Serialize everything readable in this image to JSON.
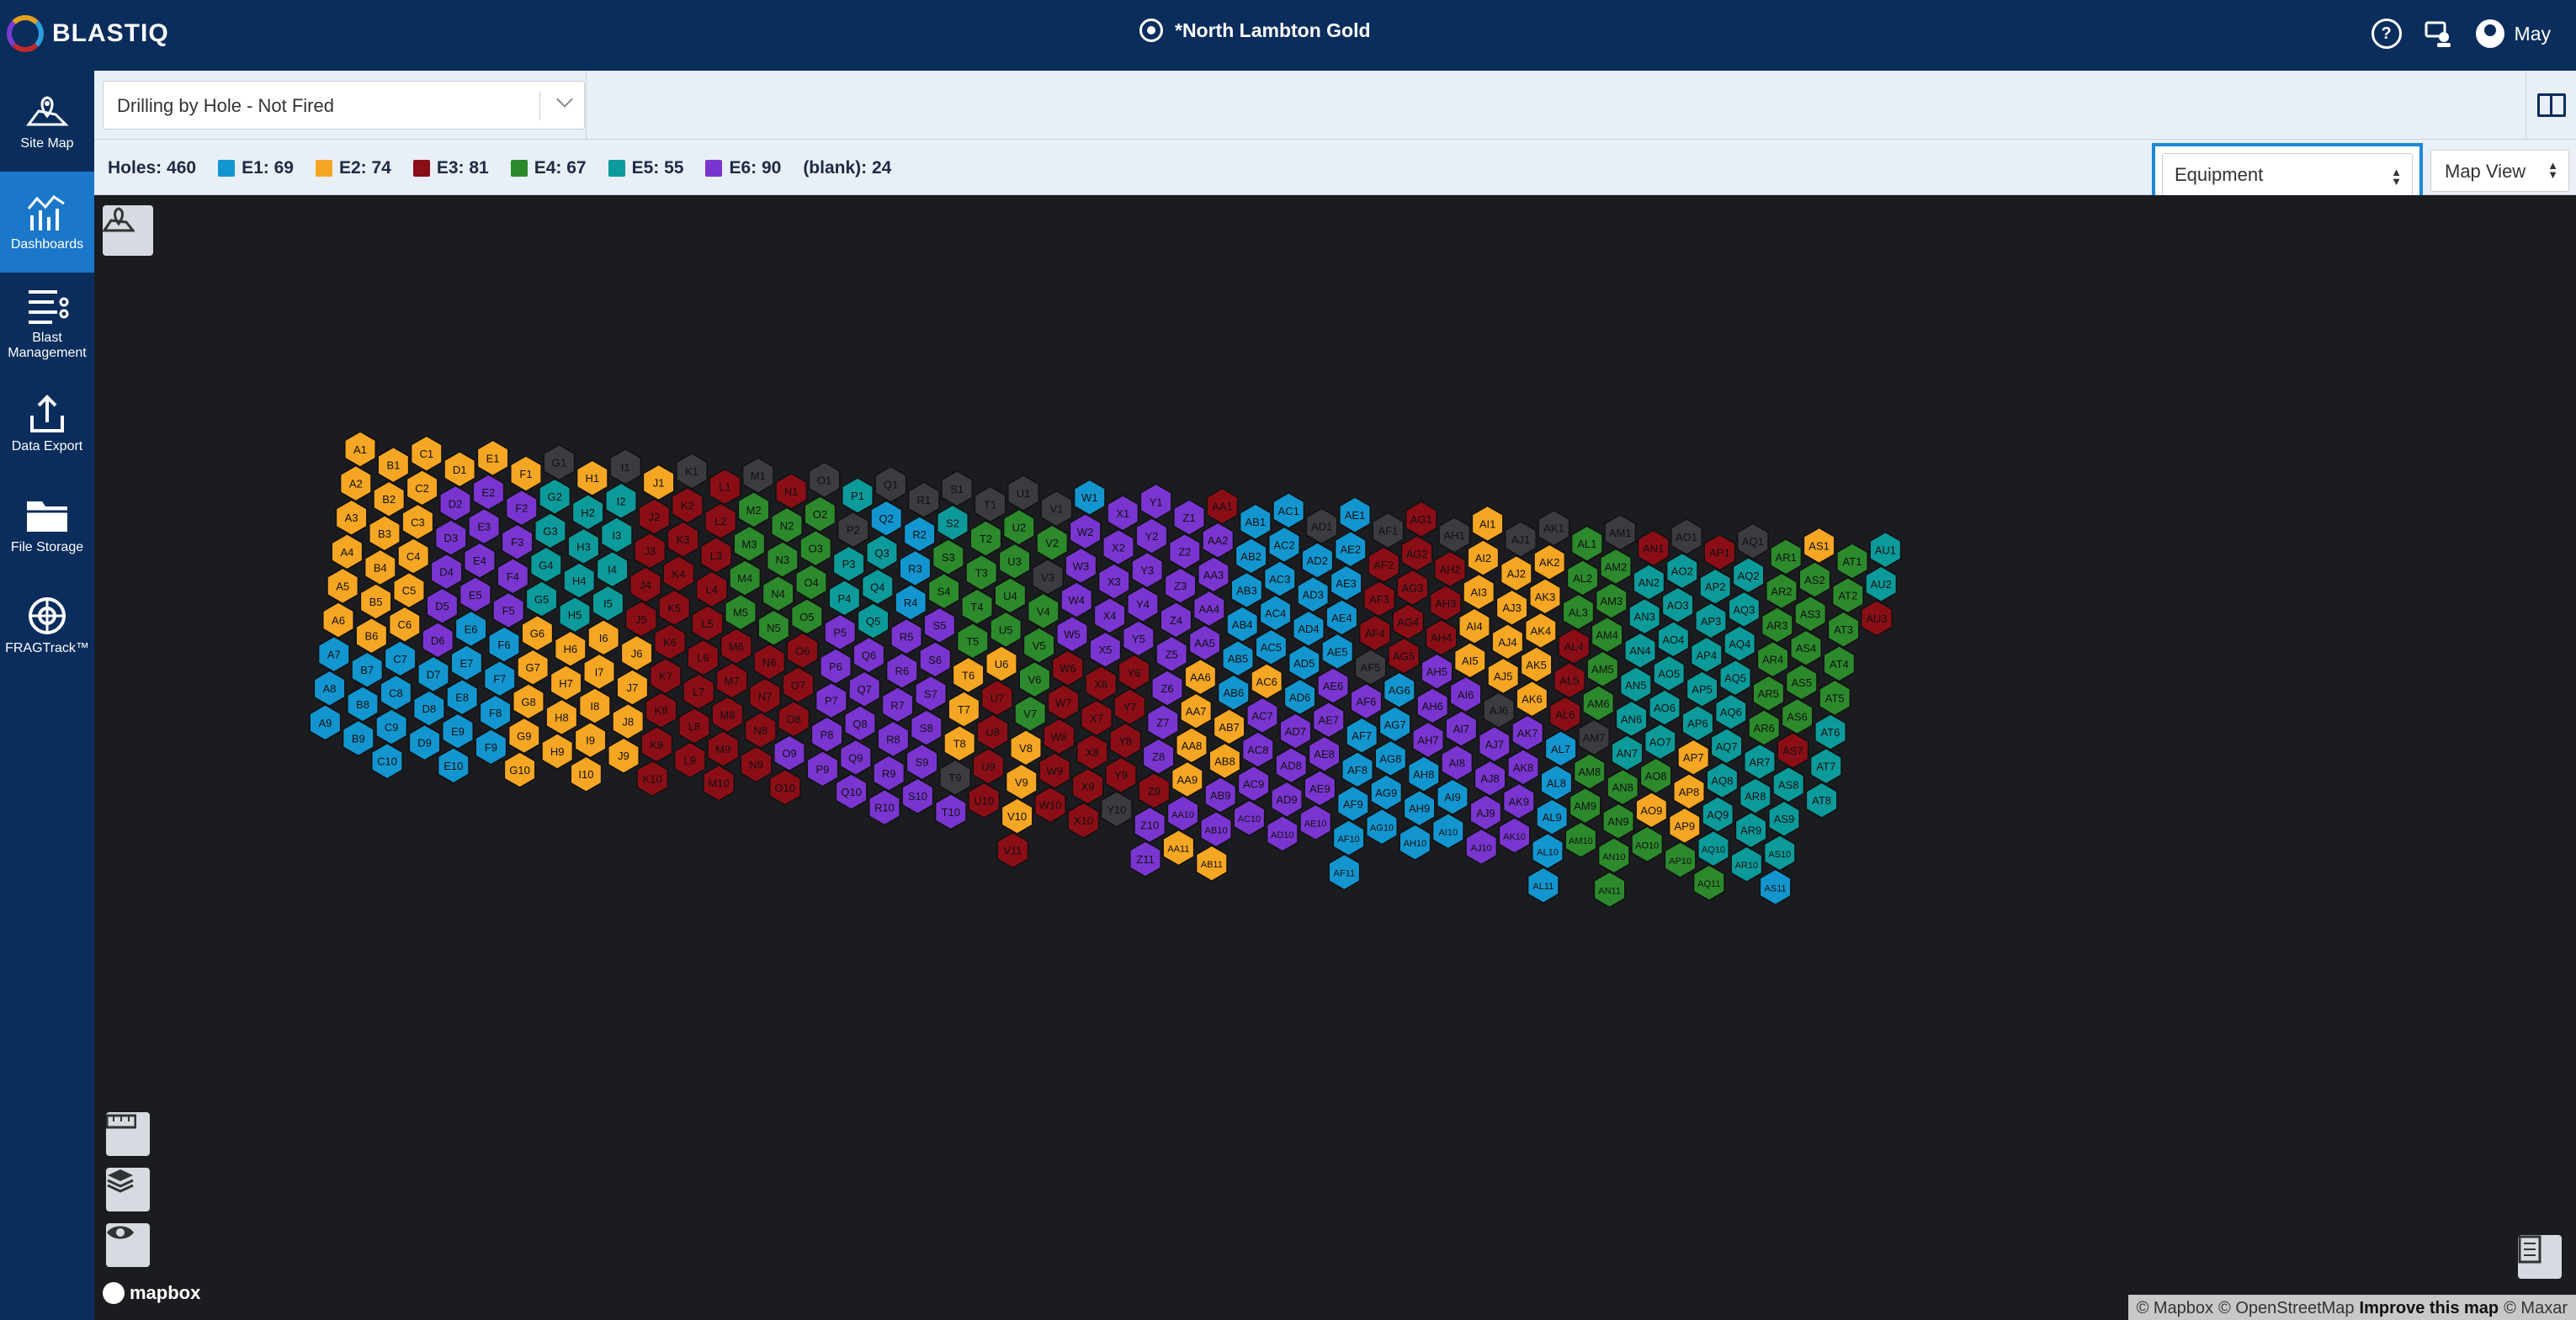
{
  "app": {
    "logo_text": "BLASTIQ",
    "site_title": "*North Lambton Gold",
    "user_name": "May"
  },
  "sidebar": {
    "items": [
      {
        "label": "Site Map",
        "icon": "map-pin-icon",
        "active": false
      },
      {
        "label": "Dashboards",
        "icon": "dashboard-chart-icon",
        "active": true
      },
      {
        "label": "Blast Management",
        "icon": "blast-management-icon",
        "active": false
      },
      {
        "label": "Data Export",
        "icon": "upload-icon",
        "active": false
      },
      {
        "label": "File Storage",
        "icon": "folder-icon",
        "active": false
      },
      {
        "label": "FRAGTrack™",
        "icon": "fragtrack-icon",
        "active": false
      }
    ]
  },
  "toolbar": {
    "report_select_value": "Drilling by Hole - Not Fired"
  },
  "legend": {
    "holes": "Holes: 460",
    "items": [
      {
        "label": "E1: 69",
        "color": "#1396cf"
      },
      {
        "label": "E2: 74",
        "color": "#f5a623"
      },
      {
        "label": "E3: 81",
        "color": "#8b0e17"
      },
      {
        "label": "E4: 67",
        "color": "#2c8a2c"
      },
      {
        "label": "E5: 55",
        "color": "#0d9a9a"
      },
      {
        "label": "E6: 90",
        "color": "#7a35d0"
      }
    ],
    "blank": "(blank): 24"
  },
  "controls": {
    "color_by": "Equipment",
    "view_mode": "Map View"
  },
  "map": {
    "blank_color": "#3b3c40",
    "mapbox_label": "mapbox",
    "attribution": [
      "© Mapbox",
      "© OpenStreetMap",
      "Improve this map",
      "© Maxar"
    ],
    "columns": [
      {
        "letter": "A",
        "labels": [
          "A1",
          "A2",
          "A3",
          "A4",
          "A5",
          "A6",
          "A7",
          "A8",
          "A9"
        ],
        "e": [
          2,
          2,
          2,
          2,
          2,
          2,
          1,
          1,
          1
        ]
      },
      {
        "letter": "B",
        "labels": [
          "B1",
          "B2",
          "B3",
          "B4",
          "B5",
          "B6",
          "B7",
          "B8",
          "B9"
        ],
        "e": [
          2,
          2,
          2,
          2,
          2,
          2,
          1,
          1,
          1
        ]
      },
      {
        "letter": "C",
        "labels": [
          "C1",
          "C2",
          "C3",
          "C4",
          "C5",
          "C6",
          "C7",
          "C8",
          "C9",
          "C10"
        ],
        "e": [
          2,
          2,
          2,
          2,
          2,
          2,
          1,
          1,
          1,
          1
        ]
      },
      {
        "letter": "D",
        "labels": [
          "D1",
          "D2",
          "D3",
          "D4",
          "D5",
          "D6",
          "D7",
          "D8",
          "D9"
        ],
        "e": [
          2,
          6,
          6,
          6,
          6,
          6,
          1,
          1,
          1
        ]
      },
      {
        "letter": "E",
        "labels": [
          "E1",
          "E2",
          "E3",
          "E4",
          "E5",
          "E6",
          "E7",
          "E8",
          "E9",
          "E10"
        ],
        "e": [
          2,
          6,
          6,
          6,
          6,
          1,
          1,
          1,
          1,
          1
        ]
      },
      {
        "letter": "F",
        "labels": [
          "F1",
          "F2",
          "F3",
          "F4",
          "F5",
          "F6",
          "F7",
          "F8",
          "F9"
        ],
        "e": [
          2,
          6,
          6,
          6,
          6,
          1,
          1,
          1,
          1
        ]
      },
      {
        "letter": "G",
        "labels": [
          "G1",
          "G2",
          "G3",
          "G4",
          "G5",
          "G6",
          "G7",
          "G8",
          "G9",
          "G10"
        ],
        "e": [
          0,
          5,
          5,
          5,
          5,
          2,
          2,
          2,
          2,
          2
        ]
      },
      {
        "letter": "H",
        "labels": [
          "H1",
          "H2",
          "H3",
          "H4",
          "H5",
          "H6",
          "H7",
          "H8",
          "H9"
        ],
        "e": [
          2,
          5,
          5,
          5,
          5,
          2,
          2,
          2,
          2
        ]
      },
      {
        "letter": "I",
        "labels": [
          "I1",
          "I2",
          "I3",
          "I4",
          "I5",
          "I6",
          "I7",
          "I8",
          "I9",
          "I10"
        ],
        "e": [
          0,
          5,
          5,
          5,
          5,
          2,
          2,
          2,
          2,
          2
        ]
      },
      {
        "letter": "J",
        "labels": [
          "J1",
          "J2",
          "J3",
          "J4",
          "J5",
          "J6",
          "J7",
          "J8",
          "J9"
        ],
        "e": [
          2,
          3,
          3,
          3,
          3,
          2,
          2,
          2,
          2
        ]
      },
      {
        "letter": "K",
        "labels": [
          "K1",
          "K2",
          "K3",
          "K4",
          "K5",
          "K6",
          "K7",
          "K8",
          "K9",
          "K10"
        ],
        "e": [
          0,
          3,
          3,
          3,
          3,
          3,
          3,
          3,
          3,
          3
        ]
      },
      {
        "letter": "L",
        "labels": [
          "L1",
          "L2",
          "L3",
          "L4",
          "L5",
          "L6",
          "L7",
          "L8",
          "L9"
        ],
        "e": [
          3,
          3,
          3,
          3,
          3,
          3,
          3,
          3,
          3
        ]
      },
      {
        "letter": "M",
        "labels": [
          "M1",
          "M2",
          "M3",
          "M4",
          "M5",
          "M6",
          "M7",
          "M8",
          "M9",
          "M10"
        ],
        "e": [
          0,
          4,
          4,
          4,
          4,
          3,
          3,
          3,
          3,
          3
        ]
      },
      {
        "letter": "N",
        "labels": [
          "N1",
          "N2",
          "N3",
          "N4",
          "N5",
          "N6",
          "N7",
          "N8",
          "N9"
        ],
        "e": [
          3,
          4,
          4,
          4,
          4,
          3,
          3,
          3,
          3
        ]
      },
      {
        "letter": "O",
        "labels": [
          "O1",
          "O2",
          "O3",
          "O4",
          "O5",
          "O6",
          "O7",
          "O8",
          "O9",
          "O10"
        ],
        "e": [
          0,
          4,
          4,
          4,
          4,
          3,
          3,
          3,
          6,
          3
        ]
      },
      {
        "letter": "P",
        "labels": [
          "P1",
          "P2",
          "P3",
          "P4",
          "P5",
          "P6",
          "P7",
          "P8",
          "P9"
        ],
        "e": [
          5,
          0,
          5,
          5,
          6,
          6,
          6,
          6,
          6
        ]
      },
      {
        "letter": "Q",
        "labels": [
          "Q1",
          "Q2",
          "Q3",
          "Q4",
          "Q5",
          "Q6",
          "Q7",
          "Q8",
          "Q9",
          "Q10"
        ],
        "e": [
          0,
          1,
          5,
          5,
          5,
          6,
          6,
          6,
          6,
          6
        ]
      },
      {
        "letter": "R",
        "labels": [
          "R1",
          "R2",
          "R3",
          "R4",
          "R5",
          "R6",
          "R7",
          "R8",
          "R9",
          "R10"
        ],
        "e": [
          0,
          1,
          1,
          1,
          6,
          6,
          6,
          6,
          6,
          6
        ]
      },
      {
        "letter": "S",
        "labels": [
          "S1",
          "S2",
          "S3",
          "S4",
          "S5",
          "S6",
          "S7",
          "S8",
          "S9",
          "S10"
        ],
        "e": [
          0,
          5,
          4,
          4,
          6,
          6,
          6,
          6,
          6,
          6
        ]
      },
      {
        "letter": "T",
        "labels": [
          "T1",
          "T2",
          "T3",
          "T4",
          "T5",
          "T6",
          "T7",
          "T8",
          "T9",
          "T10"
        ],
        "e": [
          0,
          4,
          4,
          4,
          4,
          2,
          2,
          2,
          0,
          6
        ]
      },
      {
        "letter": "U",
        "labels": [
          "U1",
          "U2",
          "U3",
          "U4",
          "U5",
          "U6",
          "U7",
          "U8",
          "U9",
          "U10"
        ],
        "e": [
          0,
          4,
          4,
          4,
          4,
          2,
          3,
          3,
          3,
          3
        ]
      },
      {
        "letter": "V",
        "labels": [
          "V1",
          "V2",
          "V3",
          "V4",
          "V5",
          "V6",
          "V7",
          "V8",
          "V9",
          "V10",
          "V11"
        ],
        "e": [
          0,
          4,
          0,
          4,
          4,
          4,
          4,
          2,
          2,
          2,
          3
        ]
      },
      {
        "letter": "W",
        "labels": [
          "W1",
          "W2",
          "W3",
          "W4",
          "W5",
          "W6",
          "W7",
          "W8",
          "W9",
          "W10"
        ],
        "e": [
          1,
          6,
          6,
          6,
          6,
          3,
          3,
          3,
          3,
          3
        ]
      },
      {
        "letter": "X",
        "labels": [
          "X1",
          "X2",
          "X3",
          "X4",
          "X5",
          "X6",
          "X7",
          "X8",
          "X9",
          "X10"
        ],
        "e": [
          6,
          6,
          6,
          6,
          6,
          3,
          3,
          3,
          3,
          3
        ]
      },
      {
        "letter": "Y",
        "labels": [
          "Y1",
          "Y2",
          "Y3",
          "Y4",
          "Y5",
          "Y6",
          "Y7",
          "Y8",
          "Y9",
          "Y10"
        ],
        "e": [
          6,
          6,
          6,
          6,
          6,
          3,
          3,
          3,
          3,
          0
        ]
      },
      {
        "letter": "Z",
        "labels": [
          "Z1",
          "Z2",
          "Z3",
          "Z4",
          "Z5",
          "Z6",
          "Z7",
          "Z8",
          "Z9",
          "Z10",
          "Z11"
        ],
        "e": [
          6,
          6,
          6,
          6,
          6,
          6,
          6,
          6,
          3,
          6,
          6
        ]
      },
      {
        "letter": "AA",
        "labels": [
          "AA1",
          "AA2",
          "AA3",
          "AA4",
          "AA5",
          "AA6",
          "AA7",
          "AA8",
          "AA9",
          "AA10",
          "AA11"
        ],
        "e": [
          3,
          6,
          6,
          6,
          6,
          2,
          2,
          2,
          2,
          6,
          2
        ]
      },
      {
        "letter": "AB",
        "labels": [
          "AB1",
          "AB2",
          "AB3",
          "AB4",
          "AB5",
          "AB6",
          "AB7",
          "AB8",
          "AB9",
          "AB10",
          "AB11"
        ],
        "e": [
          1,
          1,
          1,
          1,
          1,
          1,
          2,
          2,
          6,
          6,
          2
        ]
      },
      {
        "letter": "AC",
        "labels": [
          "AC1",
          "AC2",
          "AC3",
          "AC4",
          "AC5",
          "AC6",
          "AC7",
          "AC8",
          "AC9",
          "AC10"
        ],
        "e": [
          1,
          1,
          1,
          1,
          1,
          2,
          6,
          6,
          6,
          6
        ]
      },
      {
        "letter": "AD",
        "labels": [
          "AD1",
          "AD2",
          "AD3",
          "AD4",
          "AD5",
          "AD6",
          "AD7",
          "AD8",
          "AD9",
          "AD10"
        ],
        "e": [
          0,
          1,
          1,
          1,
          1,
          1,
          6,
          6,
          6,
          6
        ]
      },
      {
        "letter": "AE",
        "labels": [
          "AE1",
          "AE2",
          "AE3",
          "AE4",
          "AE5",
          "AE6",
          "AE7",
          "AE8",
          "AE9",
          "AE10"
        ],
        "e": [
          1,
          1,
          1,
          1,
          1,
          6,
          6,
          6,
          6,
          6
        ]
      },
      {
        "letter": "AF",
        "labels": [
          "AF1",
          "AF2",
          "AF3",
          "AF4",
          "AF5",
          "AF6",
          "AF7",
          "AF8",
          "AF9",
          "AF10",
          "AF11"
        ],
        "e": [
          0,
          3,
          3,
          3,
          0,
          6,
          1,
          1,
          1,
          1,
          1
        ]
      },
      {
        "letter": "AG",
        "labels": [
          "AG1",
          "AG2",
          "AG3",
          "AG4",
          "AG5",
          "AG6",
          "AG7",
          "AG8",
          "AG9",
          "AG10"
        ],
        "e": [
          3,
          3,
          3,
          3,
          3,
          1,
          1,
          1,
          1,
          1
        ]
      },
      {
        "letter": "AH",
        "labels": [
          "AH1",
          "AH2",
          "AH3",
          "AH4",
          "AH5",
          "AH6",
          "AH7",
          "AH8",
          "AH9",
          "AH10"
        ],
        "e": [
          0,
          3,
          3,
          3,
          6,
          6,
          6,
          1,
          1,
          1
        ]
      },
      {
        "letter": "AI",
        "labels": [
          "AI1",
          "AI2",
          "AI3",
          "AI4",
          "AI5",
          "AI6",
          "AI7",
          "AI8",
          "AI9",
          "AI10"
        ],
        "e": [
          2,
          2,
          2,
          2,
          2,
          6,
          6,
          6,
          1,
          1
        ]
      },
      {
        "letter": "AJ",
        "labels": [
          "AJ1",
          "AJ2",
          "AJ3",
          "AJ4",
          "AJ5",
          "AJ6",
          "AJ7",
          "AJ8",
          "AJ9",
          "AJ10"
        ],
        "e": [
          0,
          2,
          2,
          2,
          2,
          0,
          6,
          6,
          6,
          6
        ]
      },
      {
        "letter": "AK",
        "labels": [
          "AK1",
          "AK2",
          "AK3",
          "AK4",
          "AK5",
          "AK6",
          "AK7",
          "AK8",
          "AK9",
          "AK10"
        ],
        "e": [
          0,
          2,
          2,
          2,
          2,
          2,
          6,
          6,
          6,
          6
        ]
      },
      {
        "letter": "AL",
        "labels": [
          "AL1",
          "AL2",
          "AL3",
          "AL4",
          "AL5",
          "AL6",
          "AL7",
          "AL8",
          "AL9",
          "AL10",
          "AL11"
        ],
        "e": [
          4,
          4,
          4,
          3,
          3,
          3,
          1,
          1,
          1,
          1,
          1
        ]
      },
      {
        "letter": "AM",
        "labels": [
          "AM1",
          "AM2",
          "AM3",
          "AM4",
          "AM5",
          "AM6",
          "AM7",
          "AM8",
          "AM9",
          "AM10"
        ],
        "e": [
          0,
          4,
          4,
          4,
          4,
          4,
          0,
          4,
          4,
          4
        ]
      },
      {
        "letter": "AN",
        "labels": [
          "AN1",
          "AN2",
          "AN3",
          "AN4",
          "AN5",
          "AN6",
          "AN7",
          "AN8",
          "AN9",
          "AN10",
          "AN11"
        ],
        "e": [
          3,
          5,
          5,
          5,
          5,
          5,
          5,
          4,
          4,
          4,
          4
        ]
      },
      {
        "letter": "AO",
        "labels": [
          "AO1",
          "AO2",
          "AO3",
          "AO4",
          "AO5",
          "AO6",
          "AO7",
          "AO8",
          "AO9",
          "AO10"
        ],
        "e": [
          0,
          5,
          5,
          5,
          5,
          5,
          5,
          4,
          2,
          4
        ]
      },
      {
        "letter": "AP",
        "labels": [
          "AP1",
          "AP2",
          "AP3",
          "AP4",
          "AP5",
          "AP6",
          "AP7",
          "AP8",
          "AP9",
          "AP10"
        ],
        "e": [
          3,
          5,
          5,
          5,
          5,
          5,
          2,
          2,
          2,
          4
        ]
      },
      {
        "letter": "AQ",
        "labels": [
          "AQ1",
          "AQ2",
          "AQ3",
          "AQ4",
          "AQ5",
          "AQ6",
          "AQ7",
          "AQ8",
          "AQ9",
          "AQ10",
          "AQ11"
        ],
        "e": [
          0,
          5,
          5,
          5,
          5,
          5,
          5,
          5,
          5,
          5,
          4
        ]
      },
      {
        "letter": "AR",
        "labels": [
          "AR1",
          "AR2",
          "AR3",
          "AR4",
          "AR5",
          "AR6",
          "AR7",
          "AR8",
          "AR9",
          "AR10"
        ],
        "e": [
          4,
          4,
          4,
          4,
          4,
          4,
          5,
          5,
          5,
          5
        ]
      },
      {
        "letter": "AS",
        "labels": [
          "AS1",
          "AS2",
          "AS3",
          "AS4",
          "AS5",
          "AS6",
          "AS7",
          "AS8",
          "AS9",
          "AS10",
          "AS11"
        ],
        "e": [
          2,
          4,
          4,
          4,
          4,
          4,
          3,
          5,
          5,
          5,
          1
        ]
      },
      {
        "letter": "AT",
        "labels": [
          "AT1",
          "AT2",
          "AT3",
          "AT4",
          "AT5",
          "AT6",
          "AT7",
          "AT8"
        ],
        "e": [
          4,
          4,
          4,
          4,
          4,
          5,
          5,
          5
        ]
      },
      {
        "letter": "AU",
        "labels": [
          "AU1",
          "AU2",
          "AU3"
        ],
        "e": [
          5,
          5,
          3
        ]
      }
    ]
  }
}
